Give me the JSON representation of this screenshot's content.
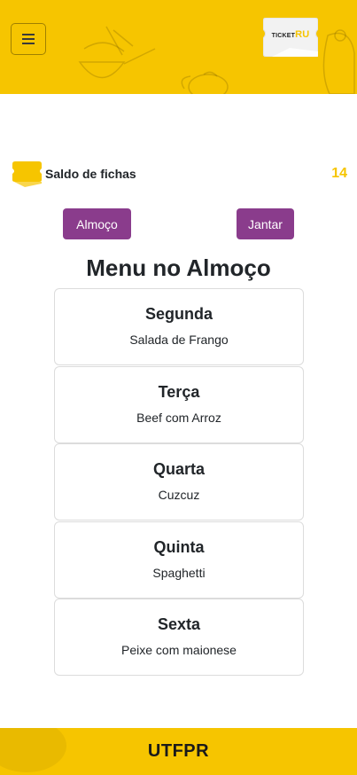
{
  "header": {
    "logo_prefix": "TICKET",
    "logo_accent": "RU",
    "menu_icon": "hamburger-icon"
  },
  "saldo": {
    "label": "Saldo de fichas",
    "value": "14",
    "icon": "ticket-icon"
  },
  "meal_buttons": {
    "lunch": "Almoço",
    "dinner": "Jantar"
  },
  "menu": {
    "title": "Menu no Almoço",
    "days": [
      {
        "day": "Segunda",
        "dish": "Salada de Frango"
      },
      {
        "day": "Terça",
        "dish": "Beef com Arroz"
      },
      {
        "day": "Quarta",
        "dish": "Cuzcuz"
      },
      {
        "day": "Quinta",
        "dish": "Spaghetti"
      },
      {
        "day": "Sexta",
        "dish": "Peixe com maionese"
      }
    ]
  },
  "footer": {
    "text": "UTFPR"
  },
  "colors": {
    "brand_yellow": "#f6c500",
    "button_purple": "#8a3c8c"
  }
}
